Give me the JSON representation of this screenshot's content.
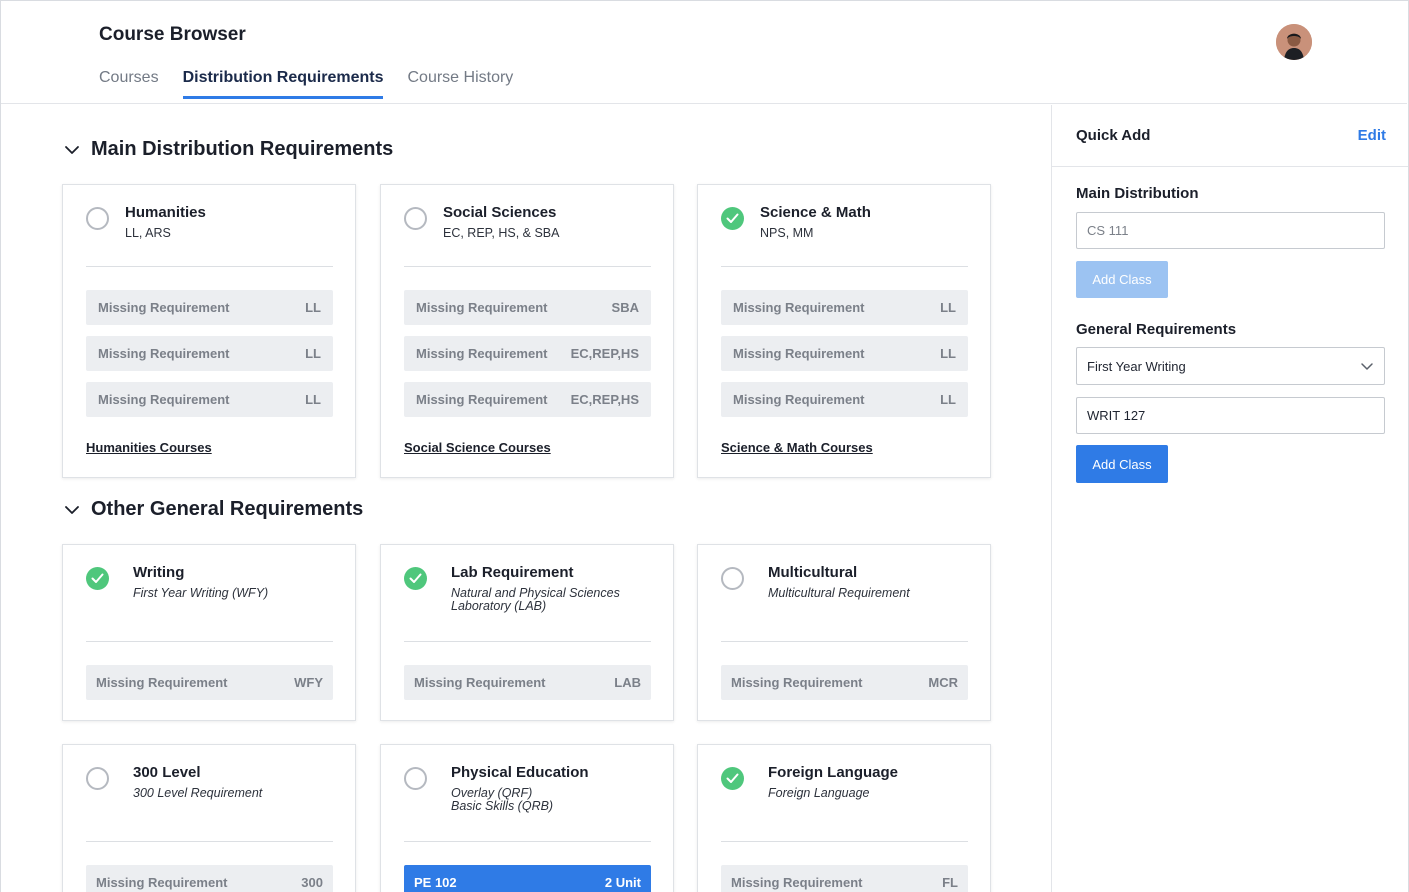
{
  "header": {
    "title": "Course Browser",
    "tabs": [
      {
        "label": "Courses",
        "active": false
      },
      {
        "label": "Distribution Requirements",
        "active": true
      },
      {
        "label": "Course History",
        "active": false
      }
    ],
    "avatar": "user-avatar"
  },
  "sections": {
    "main": {
      "title": "Main Distribution Requirements"
    },
    "other": {
      "title": "Other General Requirements"
    }
  },
  "cards": {
    "humanities": {
      "title": "Humanities",
      "sub": "LL, ARS",
      "done": false,
      "reqs": [
        {
          "label": "Missing Requirement",
          "code": "LL"
        },
        {
          "label": "Missing Requirement",
          "code": "LL"
        },
        {
          "label": "Missing Requirement",
          "code": "LL"
        }
      ],
      "link": "Humanities Courses"
    },
    "social": {
      "title": "Social Sciences",
      "sub": "EC, REP, HS, & SBA",
      "done": false,
      "reqs": [
        {
          "label": "Missing Requirement",
          "code": "SBA"
        },
        {
          "label": "Missing Requirement",
          "code": "EC,REP,HS"
        },
        {
          "label": "Missing Requirement",
          "code": "EC,REP,HS"
        }
      ],
      "link": "Social Science Courses"
    },
    "science": {
      "title": "Science & Math",
      "sub": "NPS, MM",
      "done": true,
      "reqs": [
        {
          "label": "Missing Requirement",
          "code": "LL"
        },
        {
          "label": "Missing Requirement",
          "code": "LL"
        },
        {
          "label": "Missing Requirement",
          "code": "LL"
        }
      ],
      "link": "Science & Math Courses"
    },
    "writing": {
      "title": "Writing",
      "sub": "First Year Writing (WFY)",
      "done": true,
      "req": {
        "label": "Missing Requirement",
        "code": "WFY"
      }
    },
    "lab": {
      "title": "Lab Requirement",
      "sub1": "Natural and Physical Sciences",
      "sub2": "Laboratory (LAB)",
      "done": true,
      "req": {
        "label": "Missing Requirement",
        "code": "LAB"
      }
    },
    "multicultural": {
      "title": "Multicultural",
      "sub": "Multicultural Requirement",
      "done": false,
      "req": {
        "label": "Missing Requirement",
        "code": "MCR"
      }
    },
    "level300": {
      "title": "300 Level",
      "sub": "300 Level Requirement",
      "done": false,
      "req": {
        "label": "Missing Requirement",
        "code": "300"
      }
    },
    "pe": {
      "title": "Physical Education",
      "sub1": "Overlay (QRF)",
      "sub2": "Basic Skills (QRB)",
      "done": false,
      "req": {
        "label": "PE 102",
        "code": "2 Unit"
      }
    },
    "language": {
      "title": "Foreign Language",
      "sub": "Foreign Language",
      "done": true,
      "req": {
        "label": "Missing Requirement",
        "code": "FL"
      }
    }
  },
  "quick_add": {
    "title": "Quick Add",
    "edit": "Edit",
    "main_label": "Main Distribution",
    "main_placeholder": "CS 111",
    "main_button": "Add Class",
    "general_label": "General Requirements",
    "general_select": "First Year Writing",
    "general_value": "WRIT 127",
    "general_button": "Add Class"
  },
  "colors": {
    "accent": "#2f7be6",
    "done": "#4fc77c",
    "disabled_button": "#9cc3f2"
  }
}
